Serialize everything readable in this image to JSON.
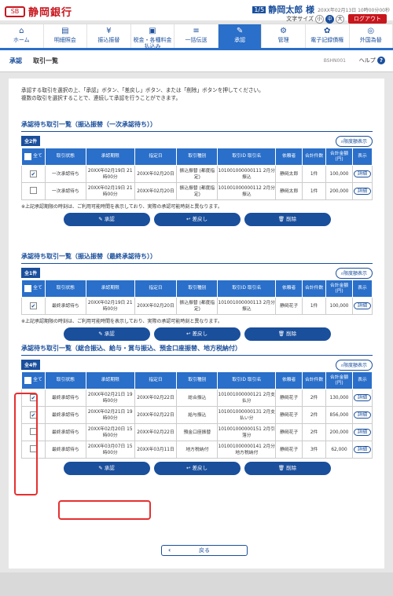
{
  "header": {
    "bank_name": "静岡銀行",
    "logo_mark": "SB",
    "user_badge": "1/5",
    "user_name": "静岡太郎 様",
    "login_time": "20XX年02月13日 10時00分00秒",
    "font_size_label": "文字サイズ",
    "font_sizes": [
      "小",
      "中",
      "大"
    ],
    "logout": "ログアウト"
  },
  "nav": [
    {
      "icon": "⌂",
      "label": "ホーム"
    },
    {
      "icon": "▤",
      "label": "明細照会"
    },
    {
      "icon": "¥",
      "label": "振込振替"
    },
    {
      "icon": "▣",
      "label": "税金・各種料金払込み"
    },
    {
      "icon": "≡",
      "label": "一括伝送"
    },
    {
      "icon": "✎",
      "label": "承認"
    },
    {
      "icon": "⚙",
      "label": "管理"
    },
    {
      "icon": "✿",
      "label": "電子記録債権"
    },
    {
      "icon": "◎",
      "label": "外国為替"
    }
  ],
  "breadcrumb": {
    "section": "承認",
    "page": "取引一覧",
    "screen_id": "BSHN001",
    "help": "ヘルプ",
    "help_icon": "?"
  },
  "intro": {
    "line1": "承認する取引を選択の上、「承認」ボタン、「差戻し」ボタン、または「削除」ボタンを押してください。",
    "line2": "複数の取引を選択することで、連続して承認を行うことができます。"
  },
  "table_headers": {
    "all": "全て",
    "status": "取引状態",
    "deadline": "承認期限",
    "date": "指定日",
    "type": "取引種別",
    "id": "取引ID 取引名",
    "requester": "依頼者",
    "count": "合計件数",
    "amount": "合計金額 (円)",
    "display": "表示"
  },
  "detail_label": "詳細",
  "note": "※上記承認期限の時刻は、ご利用可能時間を表示しており、実際の承認可能時刻と異なります。",
  "buttons": {
    "approve": "承認",
    "remand": "差戻し",
    "delete": "削除"
  },
  "limit_label": "限度額表示",
  "sections": [
    {
      "title": "承認待ち取引一覧（振込振替（一次承認待ち））",
      "count": "全2件",
      "rows": [
        {
          "checked": true,
          "status": "一次承認待ち",
          "deadline": "20XX年02月19日 21時00分",
          "date": "20XX年02月20日",
          "type": "振込振替 (都度指定)",
          "id": "101001000000111 2月分振込",
          "requester": "静岡太郎",
          "count": "1件",
          "amount": "100,000"
        },
        {
          "checked": false,
          "status": "一次承認待ち",
          "deadline": "20XX年02月19日 21時00分",
          "date": "20XX年02月20日",
          "type": "振込振替 (都度指定)",
          "id": "101001000000112 2月分振込",
          "requester": "静岡太郎",
          "count": "1件",
          "amount": "200,000"
        }
      ]
    },
    {
      "title": "承認待ち取引一覧（振込振替（最終承認待ち））",
      "count": "全1件",
      "rows": [
        {
          "checked": true,
          "status": "最終承認待ち",
          "deadline": "20XX年02月19日 21時00分",
          "date": "20XX年02月20日",
          "type": "振込振替 (都度指定)",
          "id": "101001000000113 2月分振込",
          "requester": "静岡花子",
          "count": "1件",
          "amount": "100,000"
        }
      ]
    },
    {
      "title": "承認待ち取引一覧（総合振込、給与・賞与振込、預金口座振替、地方税納付）",
      "count": "全4件",
      "rows": [
        {
          "checked": true,
          "status": "最終承認待ち",
          "deadline": "20XX年02月21日 19時00分",
          "date": "20XX年02月22日",
          "type": "総合振込",
          "id": "101001000000121 2月支払分",
          "requester": "静岡花子",
          "count": "2件",
          "amount": "130,000"
        },
        {
          "checked": true,
          "status": "最終承認待ち",
          "deadline": "20XX年02月21日 19時00分",
          "date": "20XX年02月22日",
          "type": "給与振込",
          "id": "101001000000131 2月支払い分",
          "requester": "静岡花子",
          "count": "2件",
          "amount": "856,000"
        },
        {
          "checked": false,
          "status": "最終承認待ち",
          "deadline": "20XX年02月20日 15時00分",
          "date": "20XX年02月22日",
          "type": "預金口座振替",
          "id": "101001000000151 2月引落分",
          "requester": "静岡花子",
          "count": "2件",
          "amount": "200,000"
        },
        {
          "checked": false,
          "status": "最終承認待ち",
          "deadline": "20XX年03月07日 15時00分",
          "date": "20XX年03月11日",
          "type": "地方税納付",
          "id": "101001000000141 2月分地方税納付",
          "requester": "静岡花子",
          "count": "3件",
          "amount": "62,000"
        }
      ]
    }
  ],
  "back": "戻る",
  "colors": {
    "brand_red": "#c8161d",
    "brand_blue": "#1a4f9c",
    "header_blue": "#2a6fc9",
    "highlight": "#e53030"
  }
}
